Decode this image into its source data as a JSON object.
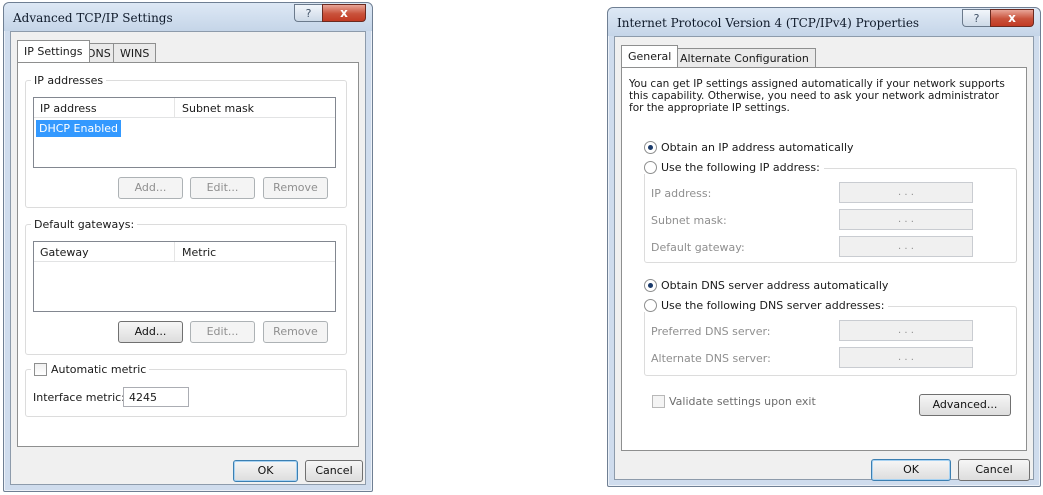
{
  "left_dialog": {
    "title": "Advanced TCP/IP Settings",
    "help_label": "?",
    "close_label": "x",
    "tabs": [
      "IP Settings",
      "DNS",
      "WINS"
    ],
    "ip_addresses": {
      "legend": "IP addresses",
      "columns": [
        "IP address",
        "Subnet mask"
      ],
      "rows": [
        "DHCP Enabled"
      ],
      "add_label": "Add...",
      "edit_label": "Edit...",
      "remove_label": "Remove"
    },
    "gateways": {
      "legend": "Default gateways:",
      "columns": [
        "Gateway",
        "Metric"
      ],
      "add_label": "Add...",
      "edit_label": "Edit...",
      "remove_label": "Remove"
    },
    "automatic_metric": {
      "label": "Automatic metric",
      "checked": false,
      "interface_metric_label": "Interface metric:",
      "interface_metric_value": "4245"
    },
    "ok_label": "OK",
    "cancel_label": "Cancel"
  },
  "right_dialog": {
    "title": "Internet Protocol Version 4 (TCP/IPv4) Properties",
    "help_label": "?",
    "close_label": "x",
    "tabs": [
      "General",
      "Alternate Configuration"
    ],
    "description": "You can get IP settings assigned automatically if your network supports this capability. Otherwise, you need to ask your network administrator for the appropriate IP settings.",
    "obtain_ip_auto": "Obtain an IP address automatically",
    "use_following_ip": "Use the following IP address:",
    "ip_fields": [
      "IP address:",
      "Subnet mask:",
      "Default gateway:"
    ],
    "obtain_dns_auto": "Obtain DNS server address automatically",
    "use_following_dns": "Use the following DNS server addresses:",
    "dns_fields": [
      "Preferred DNS server:",
      "Alternate DNS server:"
    ],
    "ip_dots": ".  .  .",
    "validate_label": "Validate settings upon exit",
    "advanced_label": "Advanced...",
    "ok_label": "OK",
    "cancel_label": "Cancel"
  }
}
